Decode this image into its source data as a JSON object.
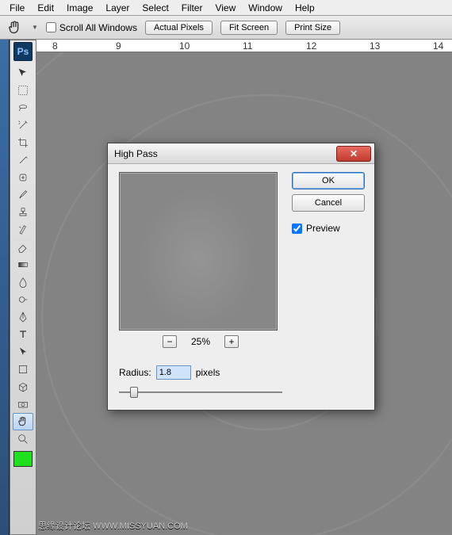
{
  "menu": {
    "items": [
      "File",
      "Edit",
      "Image",
      "Layer",
      "Select",
      "Filter",
      "View",
      "Window",
      "Help"
    ]
  },
  "options": {
    "scroll_all": "Scroll All Windows",
    "actual": "Actual Pixels",
    "fit": "Fit Screen",
    "print": "Print Size"
  },
  "ruler": {
    "marks": [
      "8",
      "9",
      "10",
      "11",
      "12",
      "13",
      "14"
    ]
  },
  "ps_badge": "Ps",
  "dialog": {
    "title": "High Pass",
    "ok": "OK",
    "cancel": "Cancel",
    "preview_label": "Preview",
    "preview_checked": true,
    "zoom_pct": "25%",
    "radius_label": "Radius:",
    "radius_value": "1.8",
    "radius_unit": "pixels"
  },
  "watermark": "思缘设计论坛  WWW.MISSYUAN.COM"
}
